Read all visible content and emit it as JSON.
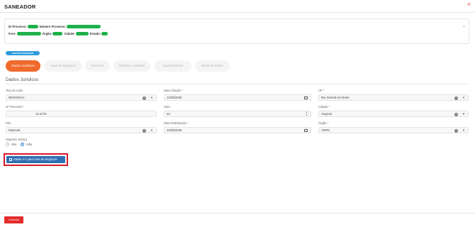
{
  "header": {
    "title": "SANEADOR",
    "close_glyph": "×"
  },
  "info": {
    "id_label": "ID Processo:",
    "id_value": "",
    "numero_label": "Número Processo:",
    "numero_value": "",
    "foro_label": "Foro:",
    "foro_value": "",
    "orgao_label": "Órgão:",
    "orgao_value": "",
    "cidade_label": "Cidade:",
    "cidade_value": "",
    "estado_label": "Estado:",
    "estado_value": "",
    "expand_icon": "chevron-down-icon"
  },
  "badge": {
    "label": "ASSUNTO SANEADOR"
  },
  "tabs": [
    {
      "label": "Dados Jurídicos",
      "active": true
    },
    {
      "label": "Área de Negócios",
      "active": false
    },
    {
      "label": "Pessoas",
      "active": false
    },
    {
      "label": "Pedidos e Valores",
      "active": false
    },
    {
      "label": "Cumprimentos",
      "active": false
    },
    {
      "label": "Baixa do Prazo",
      "active": false
    }
  ],
  "section": {
    "title": "Dados Jurídicos"
  },
  "form": {
    "tipo_acao": {
      "label": "Tipo de Ação",
      "value": "DENÚNCIA"
    },
    "data_citacao": {
      "label": "Data Citação",
      "value": "12/05/2025"
    },
    "uf": {
      "label": "UF",
      "value": "Rio Grande do Norte"
    },
    "numero_processo": {
      "label": "Nº Processo",
      "value": "13.4176"
    },
    "vara": {
      "label": "Vara",
      "value": "23"
    },
    "cidade": {
      "label": "Cidade",
      "value": "Angicos"
    },
    "rito": {
      "label": "Rito",
      "value": "Especial"
    },
    "data_distribuicao": {
      "label": "Data Distribuição",
      "value": "12/05/2025"
    },
    "orgao": {
      "label": "Órgão",
      "value": "ANPD"
    },
    "segredo": {
      "label": "Segredo Justiça",
      "option_sim": "Sim",
      "option_nao": "Não",
      "selected": "Não"
    },
    "required_mark": "*"
  },
  "actions": {
    "save_label": "Salvar e ir para Área de Negócios",
    "cancel_label": "Cancelar"
  },
  "colors": {
    "accent": "#f06a2c",
    "primary": "#2f6fb3",
    "success": "#1db14b",
    "danger": "#e32b2b",
    "info": "#2d9cdb"
  }
}
